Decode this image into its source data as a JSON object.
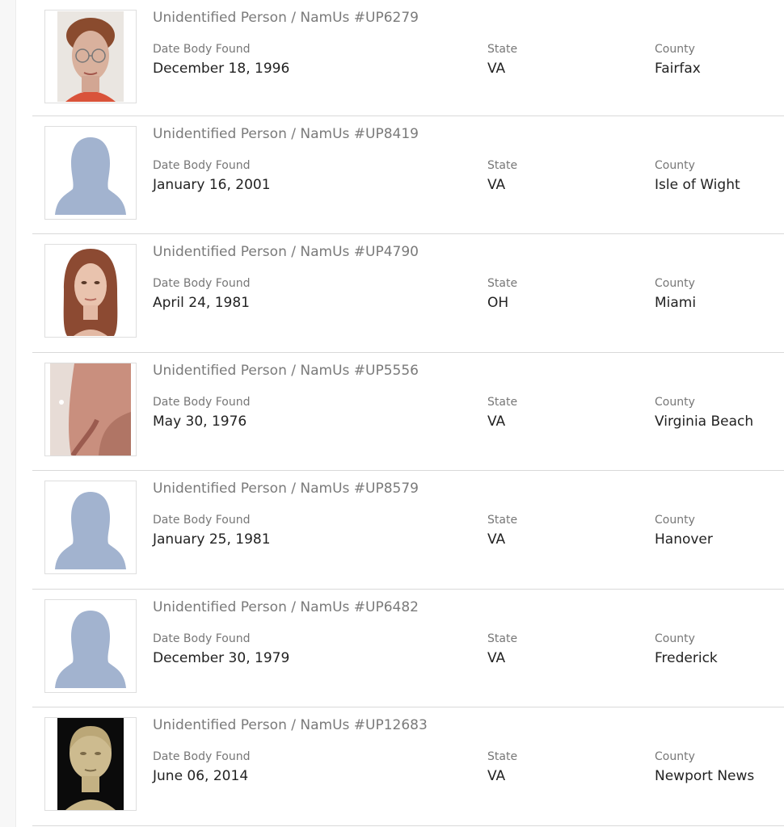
{
  "labels": {
    "date": "Date Body Found",
    "state": "State",
    "county": "County"
  },
  "cases": [
    {
      "title": "Unidentified Person / NamUs #UP6279",
      "date": "December 18, 1996",
      "state": "VA",
      "county": "Fairfax",
      "thumb": "sketch-woman-glasses"
    },
    {
      "title": "Unidentified Person / NamUs #UP8419",
      "date": "January 16, 2001",
      "state": "VA",
      "county": "Isle of Wight",
      "thumb": "silhouette-placeholder"
    },
    {
      "title": "Unidentified Person / NamUs #UP4790",
      "date": "April 24, 1981",
      "state": "OH",
      "county": "Miami",
      "thumb": "sketch-woman-long-hair"
    },
    {
      "title": "Unidentified Person / NamUs #UP5556",
      "date": "May 30, 1976",
      "state": "VA",
      "county": "Virginia Beach",
      "thumb": "photo-skin-closeup"
    },
    {
      "title": "Unidentified Person / NamUs #UP8579",
      "date": "January 25, 1981",
      "state": "VA",
      "county": "Hanover",
      "thumb": "silhouette-placeholder"
    },
    {
      "title": "Unidentified Person / NamUs #UP6482",
      "date": "December 30, 1979",
      "state": "VA",
      "county": "Frederick",
      "thumb": "silhouette-placeholder"
    },
    {
      "title": "Unidentified Person / NamUs #UP12683",
      "date": "June 06, 2014",
      "state": "VA",
      "county": "Newport News",
      "thumb": "clay-reconstruction"
    }
  ]
}
